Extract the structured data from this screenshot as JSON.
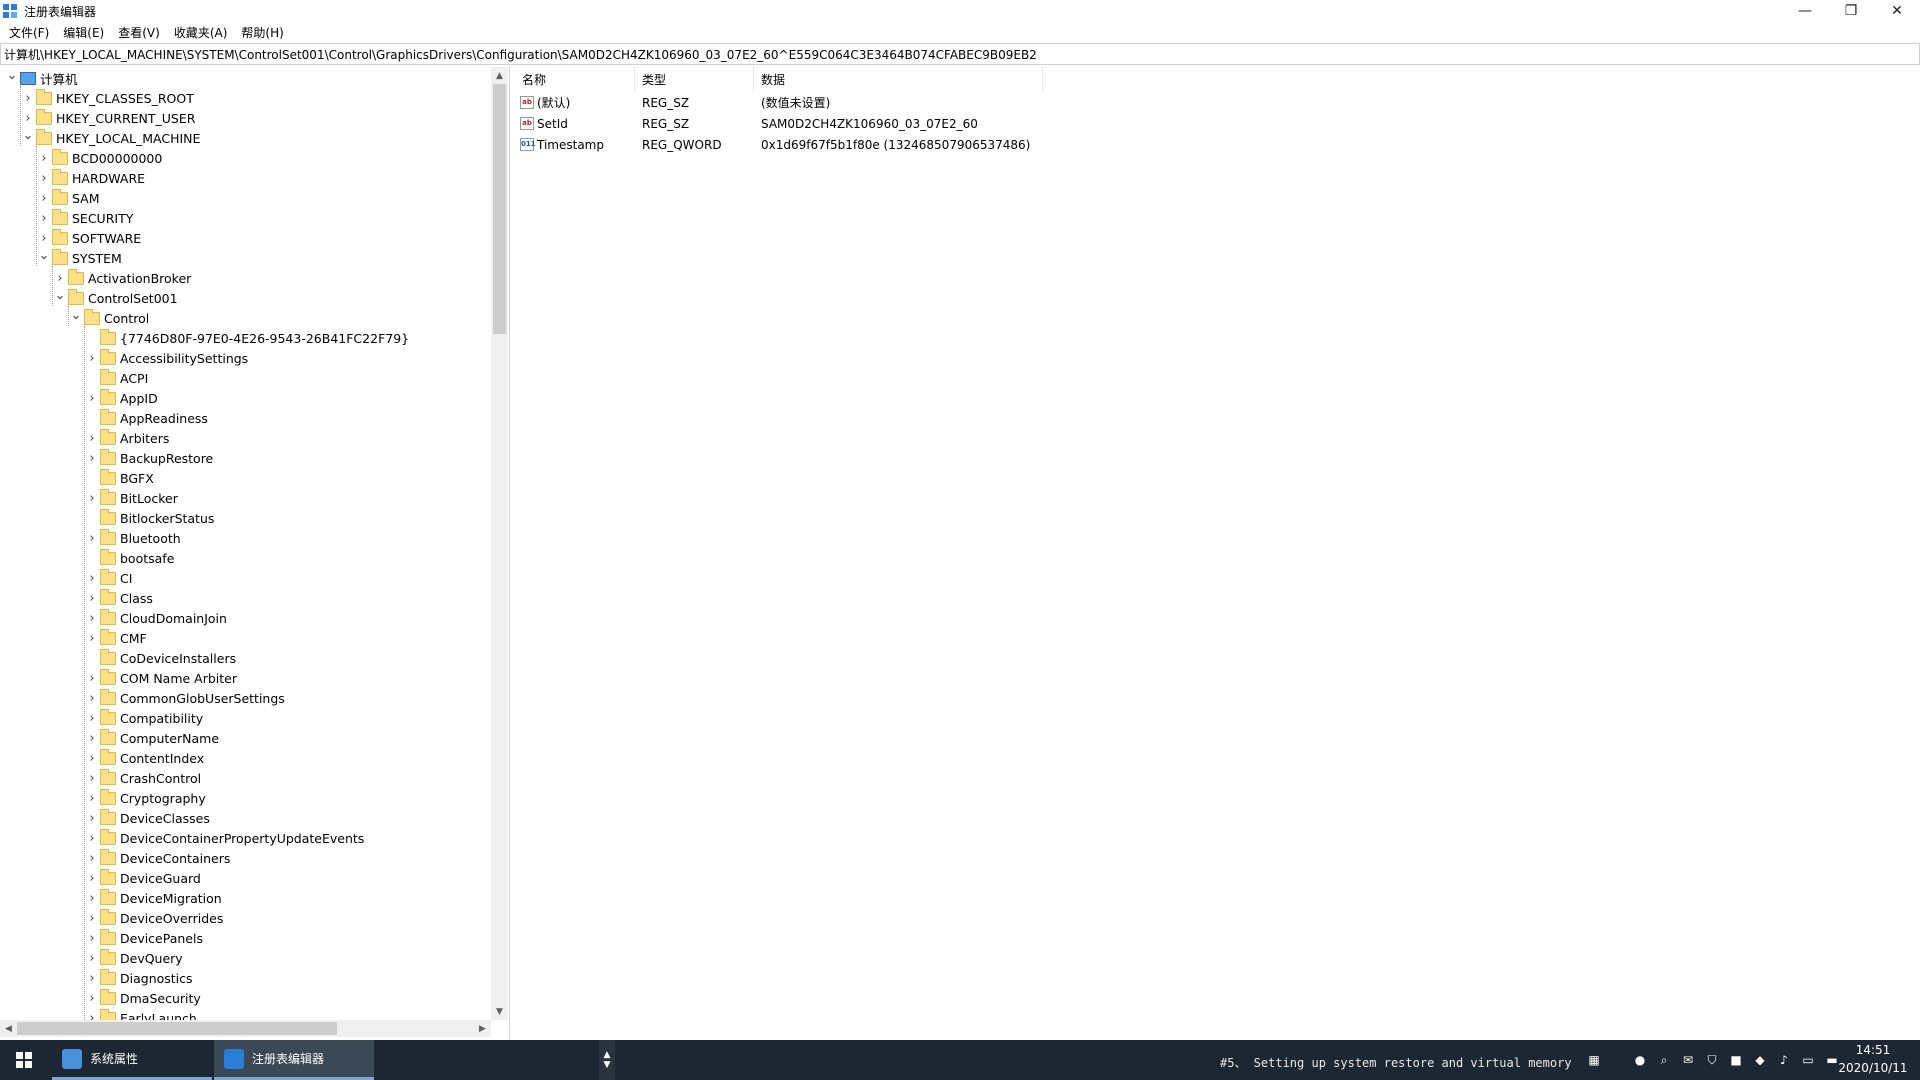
{
  "window": {
    "title": "注册表编辑器",
    "minimize": "—",
    "restore": "❐",
    "close": "✕"
  },
  "menu": [
    "文件(F)",
    "编辑(E)",
    "查看(V)",
    "收藏夹(A)",
    "帮助(H)"
  ],
  "address": "计算机\\HKEY_LOCAL_MACHINE\\SYSTEM\\ControlSet001\\Control\\GraphicsDrivers\\Configuration\\SAM0D2CH4ZK106960_03_07E2_60^E559C064C3E3464B074CFABEC9B09EB2",
  "tree": [
    {
      "label": "计算机",
      "level": 0,
      "expanded": true,
      "icon": "computer"
    },
    {
      "label": "HKEY_CLASSES_ROOT",
      "level": 1,
      "expandable": true
    },
    {
      "label": "HKEY_CURRENT_USER",
      "level": 1,
      "expandable": true
    },
    {
      "label": "HKEY_LOCAL_MACHINE",
      "level": 1,
      "expanded": true
    },
    {
      "label": "BCD00000000",
      "level": 2,
      "expandable": true
    },
    {
      "label": "HARDWARE",
      "level": 2,
      "expandable": true
    },
    {
      "label": "SAM",
      "level": 2,
      "expandable": true
    },
    {
      "label": "SECURITY",
      "level": 2,
      "expandable": true
    },
    {
      "label": "SOFTWARE",
      "level": 2,
      "expandable": true
    },
    {
      "label": "SYSTEM",
      "level": 2,
      "expanded": true
    },
    {
      "label": "ActivationBroker",
      "level": 3,
      "expandable": true
    },
    {
      "label": "ControlSet001",
      "level": 3,
      "expanded": true
    },
    {
      "label": "Control",
      "level": 4,
      "expanded": true
    },
    {
      "label": "{7746D80F-97E0-4E26-9543-26B41FC22F79}",
      "level": 5,
      "expandable": false
    },
    {
      "label": "AccessibilitySettings",
      "level": 5,
      "expandable": true
    },
    {
      "label": "ACPI",
      "level": 5,
      "expandable": false
    },
    {
      "label": "AppID",
      "level": 5,
      "expandable": true
    },
    {
      "label": "AppReadiness",
      "level": 5,
      "expandable": false
    },
    {
      "label": "Arbiters",
      "level": 5,
      "expandable": true
    },
    {
      "label": "BackupRestore",
      "level": 5,
      "expandable": true
    },
    {
      "label": "BGFX",
      "level": 5,
      "expandable": false
    },
    {
      "label": "BitLocker",
      "level": 5,
      "expandable": true
    },
    {
      "label": "BitlockerStatus",
      "level": 5,
      "expandable": false
    },
    {
      "label": "Bluetooth",
      "level": 5,
      "expandable": true
    },
    {
      "label": "bootsafe",
      "level": 5,
      "expandable": false
    },
    {
      "label": "CI",
      "level": 5,
      "expandable": true
    },
    {
      "label": "Class",
      "level": 5,
      "expandable": true
    },
    {
      "label": "CloudDomainJoin",
      "level": 5,
      "expandable": true
    },
    {
      "label": "CMF",
      "level": 5,
      "expandable": true
    },
    {
      "label": "CoDeviceInstallers",
      "level": 5,
      "expandable": false
    },
    {
      "label": "COM Name Arbiter",
      "level": 5,
      "expandable": true
    },
    {
      "label": "CommonGlobUserSettings",
      "level": 5,
      "expandable": true
    },
    {
      "label": "Compatibility",
      "level": 5,
      "expandable": true
    },
    {
      "label": "ComputerName",
      "level": 5,
      "expandable": true
    },
    {
      "label": "ContentIndex",
      "level": 5,
      "expandable": true
    },
    {
      "label": "CrashControl",
      "level": 5,
      "expandable": true
    },
    {
      "label": "Cryptography",
      "level": 5,
      "expandable": true
    },
    {
      "label": "DeviceClasses",
      "level": 5,
      "expandable": true
    },
    {
      "label": "DeviceContainerPropertyUpdateEvents",
      "level": 5,
      "expandable": true
    },
    {
      "label": "DeviceContainers",
      "level": 5,
      "expandable": true
    },
    {
      "label": "DeviceGuard",
      "level": 5,
      "expandable": true
    },
    {
      "label": "DeviceMigration",
      "level": 5,
      "expandable": true
    },
    {
      "label": "DeviceOverrides",
      "level": 5,
      "expandable": true
    },
    {
      "label": "DevicePanels",
      "level": 5,
      "expandable": true
    },
    {
      "label": "DevQuery",
      "level": 5,
      "expandable": true
    },
    {
      "label": "Diagnostics",
      "level": 5,
      "expandable": true
    },
    {
      "label": "DmaSecurity",
      "level": 5,
      "expandable": true
    },
    {
      "label": "EarlyLaunch",
      "level": 5,
      "expandable": true
    }
  ],
  "values": {
    "headers": [
      "名称",
      "类型",
      "数据"
    ],
    "rows": [
      {
        "name": "(默认)",
        "type": "REG_SZ",
        "data": "(数值未设置)",
        "icon": "string-value-icon"
      },
      {
        "name": "SetId",
        "type": "REG_SZ",
        "data": "SAM0D2CH4ZK106960_03_07E2_60",
        "icon": "string-value-icon"
      },
      {
        "name": "Timestamp",
        "type": "REG_QWORD",
        "data": "0x1d69f67f5b1f80e (132468507906537486)",
        "icon": "binary-value-icon"
      }
    ]
  },
  "taskbar": {
    "tasks": [
      {
        "label": "系统属性"
      },
      {
        "label": "注册表编辑器"
      }
    ],
    "status_text": "#5、 Setting up system restore and virtual memory",
    "clock_time": "14:51",
    "clock_date": "2020/10/11"
  }
}
